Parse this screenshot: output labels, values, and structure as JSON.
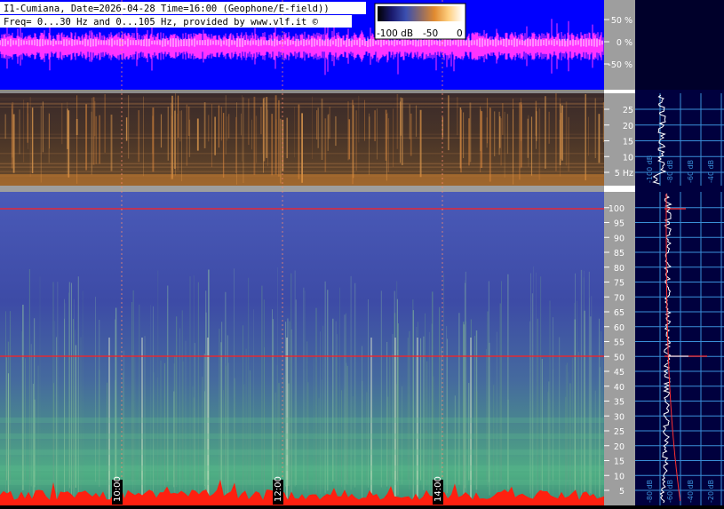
{
  "header": {
    "line1": "I1-Cumiana, Date=2026-04-28 Time=16:00 (Geophone/E-field))",
    "line2": "Freq= 0...30 Hz and 0...105 Hz, provided by www.vlf.it ©"
  },
  "color_scale": {
    "labels": [
      "-100 dB",
      "-50",
      "0"
    ],
    "stops": [
      "#000000",
      "#1a1a6e",
      "#3b4fb0",
      "#8a6a6a",
      "#e08a30",
      "#ffd080",
      "#ffffff"
    ]
  },
  "colors": {
    "waveform_bg": "#0000ff",
    "waveform": "#ff33ff",
    "right_panel_bg": "#00003e",
    "axis_strip": "#9e9e9e",
    "grid_line": "#3a8fd8",
    "time_marker": "#ff8c6e",
    "mains_line": "#ff2020"
  },
  "chart_data": [
    {
      "type": "line",
      "title": "",
      "ylim": [
        -100,
        100
      ],
      "yticks": [
        50,
        0,
        -50
      ],
      "ytick_labels": [
        "50 %",
        "0 %",
        "-50 %"
      ],
      "series": [
        {
          "values": "time-domain waveform (noise-like, ~±20 % amplitude)"
        }
      ]
    },
    {
      "type": "heatmap",
      "ylim": [
        0,
        30
      ],
      "yticks": [
        25,
        20,
        15,
        10,
        5
      ],
      "ytick_labels": [
        "25",
        "20",
        "15",
        "10",
        "5 Hz"
      ]
    },
    {
      "type": "heatmap",
      "ylim": [
        0,
        105
      ],
      "yticks": [
        100,
        95,
        90,
        85,
        80,
        75,
        70,
        65,
        60,
        55,
        50,
        45,
        40,
        35,
        30,
        25,
        20,
        15,
        10,
        5
      ],
      "ytick_labels": [
        "100",
        "95",
        "90",
        "85",
        "80",
        "75",
        "70",
        "65",
        "60",
        "55",
        "50",
        "45",
        "40",
        "35",
        "30",
        "25",
        "20",
        "15",
        "10",
        "5"
      ],
      "time_markers": [
        "10:00",
        "12:00",
        "14:00"
      ]
    },
    {
      "type": "line",
      "title": "",
      "x_tick_labels": [
        "-100 dB",
        "-80 dB",
        "-60 dB",
        "-40 dB",
        "-20 dB"
      ],
      "ylim": [
        0,
        105
      ]
    }
  ]
}
